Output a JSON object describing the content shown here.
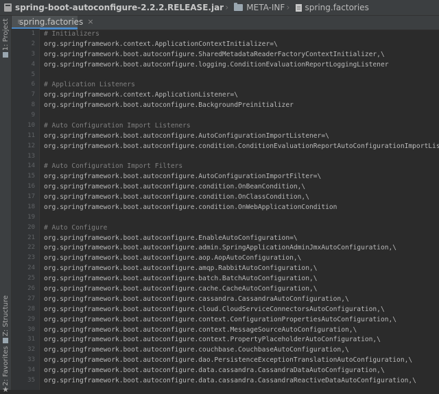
{
  "breadcrumb": {
    "jar": "spring-boot-autoconfigure-2.2.2.RELEASE.jar",
    "folder": "META-INF",
    "file": "spring.factories"
  },
  "left_toolbar": {
    "project_label": "1: Project",
    "structure_label": "Z: Structure",
    "favorites_label": "2: Favorites"
  },
  "tab": {
    "label": "spring.factories",
    "close": "×"
  },
  "editor": {
    "lines": [
      {
        "n": "1",
        "text": "# Initializers",
        "type": "comment"
      },
      {
        "n": "2",
        "text": "org.springframework.context.ApplicationContextInitializer=\\",
        "type": "code"
      },
      {
        "n": "3",
        "text": "org.springframework.boot.autoconfigure.SharedMetadataReaderFactoryContextInitializer,\\",
        "type": "code"
      },
      {
        "n": "4",
        "text": "org.springframework.boot.autoconfigure.logging.ConditionEvaluationReportLoggingListener",
        "type": "code"
      },
      {
        "n": "5",
        "text": "",
        "type": "code"
      },
      {
        "n": "6",
        "text": "# Application Listeners",
        "type": "comment"
      },
      {
        "n": "7",
        "text": "org.springframework.context.ApplicationListener=\\",
        "type": "code"
      },
      {
        "n": "8",
        "text": "org.springframework.boot.autoconfigure.BackgroundPreinitializer",
        "type": "code"
      },
      {
        "n": "9",
        "text": "",
        "type": "code"
      },
      {
        "n": "10",
        "text": "# Auto Configuration Import Listeners",
        "type": "comment"
      },
      {
        "n": "11",
        "text": "org.springframework.boot.autoconfigure.AutoConfigurationImportListener=\\",
        "type": "code"
      },
      {
        "n": "12",
        "text": "org.springframework.boot.autoconfigure.condition.ConditionEvaluationReportAutoConfigurationImportListener",
        "type": "code"
      },
      {
        "n": "13",
        "text": "",
        "type": "code"
      },
      {
        "n": "14",
        "text": "# Auto Configuration Import Filters",
        "type": "comment"
      },
      {
        "n": "15",
        "text": "org.springframework.boot.autoconfigure.AutoConfigurationImportFilter=\\",
        "type": "code"
      },
      {
        "n": "16",
        "text": "org.springframework.boot.autoconfigure.condition.OnBeanCondition,\\",
        "type": "code"
      },
      {
        "n": "17",
        "text": "org.springframework.boot.autoconfigure.condition.OnClassCondition,\\",
        "type": "code"
      },
      {
        "n": "18",
        "text": "org.springframework.boot.autoconfigure.condition.OnWebApplicationCondition",
        "type": "code"
      },
      {
        "n": "19",
        "text": "",
        "type": "code"
      },
      {
        "n": "20",
        "text": "# Auto Configure",
        "type": "comment"
      },
      {
        "n": "21",
        "text": "org.springframework.boot.autoconfigure.EnableAutoConfiguration=\\",
        "type": "code"
      },
      {
        "n": "22",
        "text": "org.springframework.boot.autoconfigure.admin.SpringApplicationAdminJmxAutoConfiguration,\\",
        "type": "code"
      },
      {
        "n": "23",
        "text": "org.springframework.boot.autoconfigure.aop.AopAutoConfiguration,\\",
        "type": "code"
      },
      {
        "n": "24",
        "text": "org.springframework.boot.autoconfigure.amqp.RabbitAutoConfiguration,\\",
        "type": "code"
      },
      {
        "n": "25",
        "text": "org.springframework.boot.autoconfigure.batch.BatchAutoConfiguration,\\",
        "type": "code"
      },
      {
        "n": "26",
        "text": "org.springframework.boot.autoconfigure.cache.CacheAutoConfiguration,\\",
        "type": "code"
      },
      {
        "n": "27",
        "text": "org.springframework.boot.autoconfigure.cassandra.CassandraAutoConfiguration,\\",
        "type": "code"
      },
      {
        "n": "28",
        "text": "org.springframework.boot.autoconfigure.cloud.CloudServiceConnectorsAutoConfiguration,\\",
        "type": "code"
      },
      {
        "n": "29",
        "text": "org.springframework.boot.autoconfigure.context.ConfigurationPropertiesAutoConfiguration,\\",
        "type": "code"
      },
      {
        "n": "30",
        "text": "org.springframework.boot.autoconfigure.context.MessageSourceAutoConfiguration,\\",
        "type": "code"
      },
      {
        "n": "31",
        "text": "org.springframework.boot.autoconfigure.context.PropertyPlaceholderAutoConfiguration,\\",
        "type": "code"
      },
      {
        "n": "32",
        "text": "org.springframework.boot.autoconfigure.couchbase.CouchbaseAutoConfiguration,\\",
        "type": "code"
      },
      {
        "n": "33",
        "text": "org.springframework.boot.autoconfigure.dao.PersistenceExceptionTranslationAutoConfiguration,\\",
        "type": "code"
      },
      {
        "n": "34",
        "text": "org.springframework.boot.autoconfigure.data.cassandra.CassandraDataAutoConfiguration,\\",
        "type": "code"
      },
      {
        "n": "35",
        "text": "org.springframework.boot.autoconfigure.data.cassandra.CassandraReactiveDataAutoConfiguration,\\",
        "type": "code"
      }
    ]
  }
}
